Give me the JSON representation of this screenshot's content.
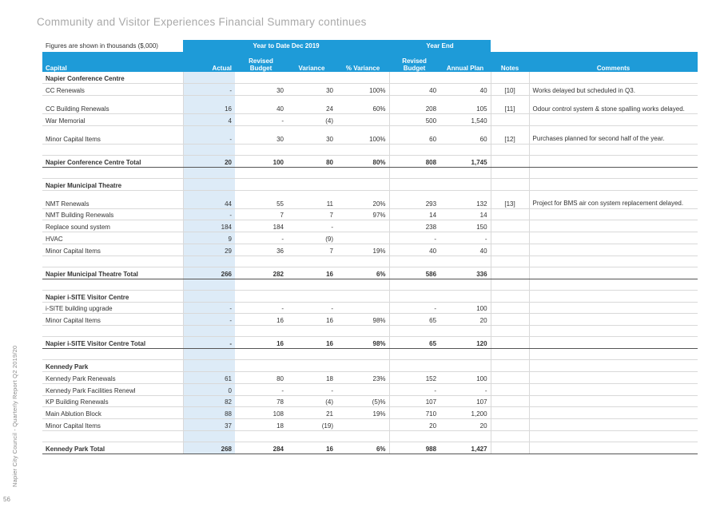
{
  "header": {
    "title": "Community and Visitor Experiences Financial Summary continues"
  },
  "side": {
    "text": "Napier City Council - Quarterly Report Q2 2019/20",
    "page_number": "56"
  },
  "table": {
    "figures_note": "Figures are shown in thousands ($,000)",
    "group_ytd": "Year to Date Dec 2019",
    "group_year_end": "Year End",
    "col_capital": "Capital",
    "col_actual": "Actual",
    "col_revised_budget": "Revised Budget",
    "col_variance": "Variance",
    "col_pct_variance": "% Variance",
    "col_revised_budget_ye": "Revised Budget",
    "col_annual_plan": "Annual Plan",
    "col_notes": "Notes",
    "col_comments": "Comments",
    "sections": [
      {
        "title": "Napier Conference Centre",
        "rows": [
          {
            "name": "CC Renewals",
            "actual": "-",
            "budget": "30",
            "variance": "30",
            "pct": "100%",
            "ye_budget": "40",
            "plan": "40",
            "note": "[10]",
            "comment": "Works delayed but scheduled in Q3."
          },
          {
            "name": "CC Building Renewals",
            "actual": "16",
            "budget": "40",
            "variance": "24",
            "pct": "60%",
            "ye_budget": "208",
            "plan": "105",
            "note": "[11]",
            "comment": "Odour control system & stone spalling works delayed."
          },
          {
            "name": "War Memorial",
            "actual": "4",
            "budget": "-",
            "variance": "(4)",
            "pct": "",
            "ye_budget": "500",
            "plan": "1,540",
            "note": "",
            "comment": ""
          },
          {
            "name": "Minor Capital Items",
            "actual": "-",
            "budget": "30",
            "variance": "30",
            "pct": "100%",
            "ye_budget": "60",
            "plan": "60",
            "note": "[12]",
            "comment": "Purchases planned for second half of the year."
          }
        ],
        "total": {
          "name": "Napier Conference Centre Total",
          "actual": "20",
          "budget": "100",
          "variance": "80",
          "pct": "80%",
          "ye_budget": "808",
          "plan": "1,745"
        }
      },
      {
        "title": "Napier Municipal Theatre",
        "rows": [
          {
            "name": "NMT Renewals",
            "actual": "44",
            "budget": "55",
            "variance": "11",
            "pct": "20%",
            "ye_budget": "293",
            "plan": "132",
            "note": "[13]",
            "comment": "Project for BMS air con system replacement delayed."
          },
          {
            "name": "NMT Building Renewals",
            "actual": "-",
            "budget": "7",
            "variance": "7",
            "pct": "97%",
            "ye_budget": "14",
            "plan": "14",
            "note": "",
            "comment": ""
          },
          {
            "name": "Replace sound system",
            "actual": "184",
            "budget": "184",
            "variance": "-",
            "pct": "",
            "ye_budget": "238",
            "plan": "150",
            "note": "",
            "comment": ""
          },
          {
            "name": "HVAC",
            "actual": "9",
            "budget": "-",
            "variance": "(9)",
            "pct": "",
            "ye_budget": "-",
            "plan": "-",
            "note": "",
            "comment": ""
          },
          {
            "name": "Minor Capital Items",
            "actual": "29",
            "budget": "36",
            "variance": "7",
            "pct": "19%",
            "ye_budget": "40",
            "plan": "40",
            "note": "",
            "comment": ""
          }
        ],
        "total": {
          "name": "Napier Municipal Theatre Total",
          "actual": "266",
          "budget": "282",
          "variance": "16",
          "pct": "6%",
          "ye_budget": "586",
          "plan": "336"
        }
      },
      {
        "title": "Napier i-SITE Visitor Centre",
        "rows": [
          {
            "name": "i-SITE building upgrade",
            "actual": "-",
            "budget": "-",
            "variance": "-",
            "pct": "",
            "ye_budget": "-",
            "plan": "100",
            "note": "",
            "comment": ""
          },
          {
            "name": "Minor Capital Items",
            "actual": "-",
            "budget": "16",
            "variance": "16",
            "pct": "98%",
            "ye_budget": "65",
            "plan": "20",
            "note": "",
            "comment": ""
          }
        ],
        "total": {
          "name": "Napier i-SITE Visitor Centre Total",
          "actual": "-",
          "budget": "16",
          "variance": "16",
          "pct": "98%",
          "ye_budget": "65",
          "plan": "120"
        }
      },
      {
        "title": "Kennedy Park",
        "rows": [
          {
            "name": "Kennedy Park Renewals",
            "actual": "61",
            "budget": "80",
            "variance": "18",
            "pct": "23%",
            "ye_budget": "152",
            "plan": "100",
            "note": "",
            "comment": ""
          },
          {
            "name": "Kennedy Park Facilities Renewl",
            "actual": "0",
            "budget": "-",
            "variance": "-",
            "pct": "",
            "ye_budget": "-",
            "plan": "-",
            "note": "",
            "comment": ""
          },
          {
            "name": "KP Building Renewals",
            "actual": "82",
            "budget": "78",
            "variance": "(4)",
            "pct": "(5)%",
            "ye_budget": "107",
            "plan": "107",
            "note": "",
            "comment": ""
          },
          {
            "name": "Main Ablution Block",
            "actual": "88",
            "budget": "108",
            "variance": "21",
            "pct": "19%",
            "ye_budget": "710",
            "plan": "1,200",
            "note": "",
            "comment": ""
          },
          {
            "name": "Minor Capital Items",
            "actual": "37",
            "budget": "18",
            "variance": "(19)",
            "pct": "",
            "ye_budget": "20",
            "plan": "20",
            "note": "",
            "comment": ""
          }
        ],
        "total": {
          "name": "Kennedy Park Total",
          "actual": "268",
          "budget": "284",
          "variance": "16",
          "pct": "6%",
          "ye_budget": "988",
          "plan": "1,427"
        }
      }
    ]
  }
}
